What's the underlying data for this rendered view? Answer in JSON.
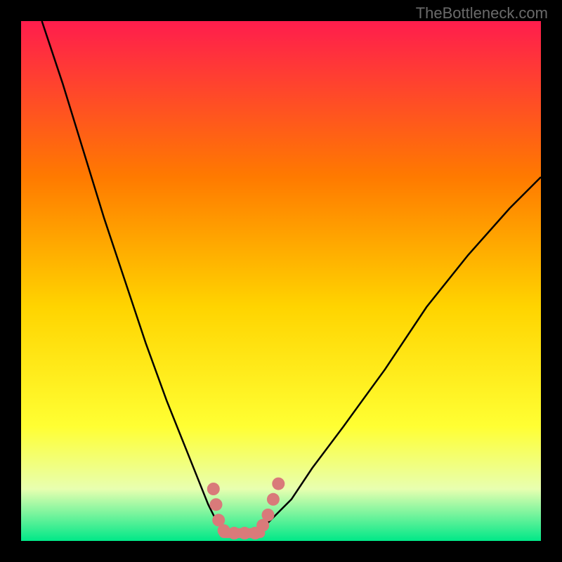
{
  "watermark": "TheBottleneck.com",
  "chart_data": {
    "type": "line",
    "title": "",
    "xlabel": "",
    "ylabel": "",
    "xlim": [
      0,
      100
    ],
    "ylim": [
      0,
      100
    ],
    "background_gradient": {
      "top": "#ff1d4d",
      "upper_mid": "#ffa500",
      "mid": "#ffff00",
      "lower_mid": "#e0ff80",
      "bottom": "#00ff88"
    },
    "curve_left": {
      "description": "Steep descending curve from top-left to valley",
      "x": [
        4,
        8,
        12,
        16,
        20,
        24,
        28,
        32,
        34,
        36,
        37.5,
        39
      ],
      "y": [
        100,
        88,
        75,
        62,
        50,
        38,
        27,
        17,
        12,
        7,
        4,
        2
      ]
    },
    "curve_right": {
      "description": "Ascending curve from valley to upper-right",
      "x": [
        46,
        48,
        52,
        56,
        62,
        70,
        78,
        86,
        94,
        100
      ],
      "y": [
        2,
        4,
        8,
        14,
        22,
        33,
        45,
        55,
        64,
        70
      ]
    },
    "valley_floor": {
      "x": [
        39,
        46
      ],
      "y": [
        1.5,
        1.5
      ]
    },
    "markers": [
      {
        "x": 37,
        "y": 10,
        "color": "#d97a7a"
      },
      {
        "x": 37.5,
        "y": 7,
        "color": "#d97a7a"
      },
      {
        "x": 38,
        "y": 4,
        "color": "#d97a7a"
      },
      {
        "x": 39,
        "y": 2,
        "color": "#d97a7a"
      },
      {
        "x": 41,
        "y": 1.5,
        "color": "#d97a7a"
      },
      {
        "x": 43,
        "y": 1.5,
        "color": "#d97a7a"
      },
      {
        "x": 45,
        "y": 1.5,
        "color": "#d97a7a"
      },
      {
        "x": 46.5,
        "y": 3,
        "color": "#d97a7a"
      },
      {
        "x": 47.5,
        "y": 5,
        "color": "#d97a7a"
      },
      {
        "x": 48.5,
        "y": 8,
        "color": "#d97a7a"
      },
      {
        "x": 49.5,
        "y": 11,
        "color": "#d97a7a"
      }
    ]
  }
}
